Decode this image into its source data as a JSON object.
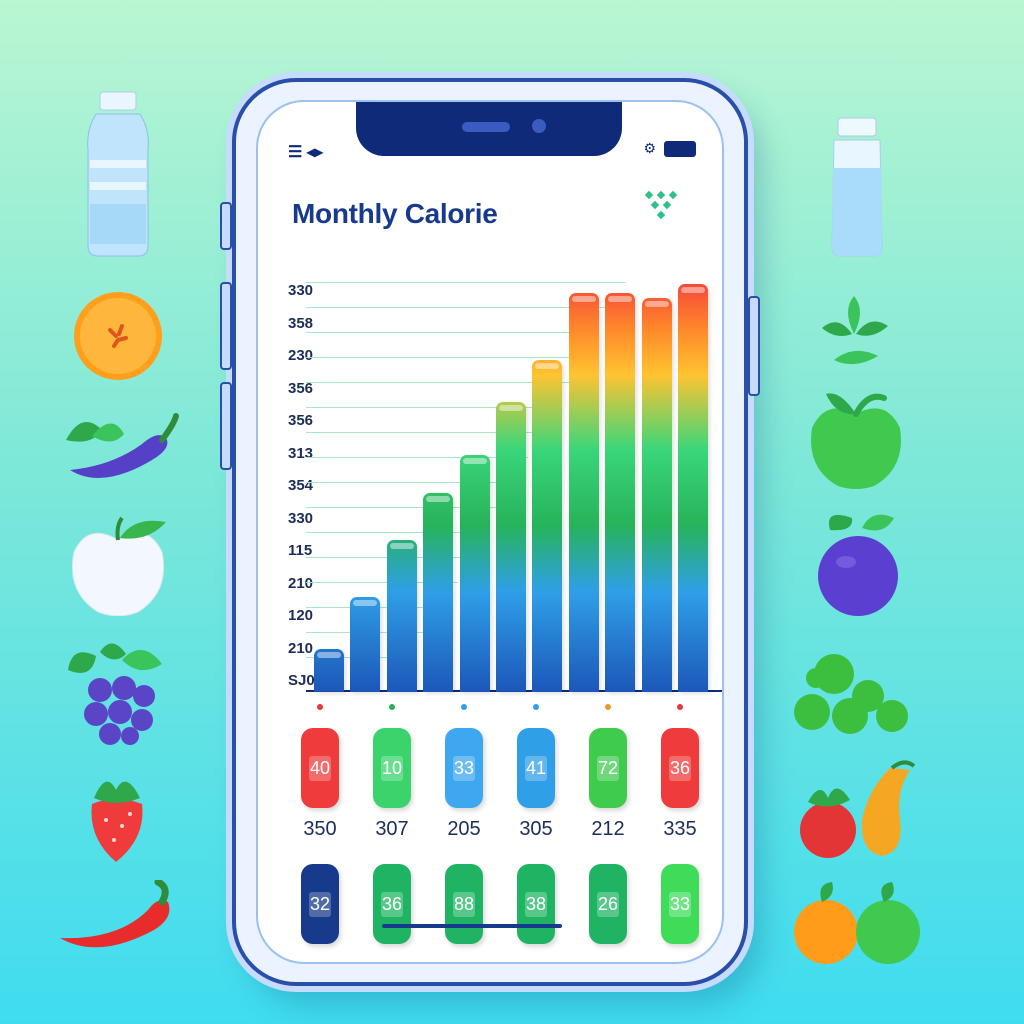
{
  "screen": {
    "title": "Monthly Calorie",
    "status_icons": {
      "left": "menu-icon",
      "right": "battery-icon"
    },
    "logo": "leaf-dots-logo"
  },
  "chart_data": {
    "type": "bar",
    "y_tick_labels": [
      "330",
      "358",
      "230",
      "356",
      "356",
      "313",
      "354",
      "330",
      "115",
      "210",
      "120",
      "210",
      "SJ0"
    ],
    "values": [
      45,
      100,
      160,
      210,
      250,
      305,
      350,
      420,
      420,
      415,
      430
    ],
    "ylim": [
      0,
      440
    ],
    "grid": true,
    "color_scheme": [
      "#f43b3b",
      "#ff8d2a",
      "#ffc331",
      "#3ad67a",
      "#27b35a",
      "#2f9fe8",
      "#1c57b8"
    ]
  },
  "summary": {
    "top_pills": [
      {
        "label": "40",
        "color": "#ef3b3b",
        "dot": "#e23a3a"
      },
      {
        "label": "10",
        "color": "#3bd36c",
        "dot": "#27b35a"
      },
      {
        "label": "33",
        "color": "#3da7f0",
        "dot": "#2f9fe8"
      },
      {
        "label": "41",
        "color": "#2f9fe8",
        "dot": "#2f9fe8"
      },
      {
        "label": "72",
        "color": "#3fcb4e",
        "dot": "#e69a2a"
      },
      {
        "label": "36",
        "color": "#ef3b3b",
        "dot": "#e23a3a"
      }
    ],
    "numbers": [
      "350",
      "307",
      "205",
      "305",
      "212",
      "335"
    ],
    "bottom_pills": [
      {
        "label": "32",
        "color": "#173a8c"
      },
      {
        "label": "36",
        "color": "#1fb463"
      },
      {
        "label": "88",
        "color": "#1fb463"
      },
      {
        "label": "38",
        "color": "#1fb463"
      },
      {
        "label": "26",
        "color": "#1fb463"
      },
      {
        "label": "33",
        "color": "#3fdc5a"
      }
    ]
  },
  "decorations": {
    "left": [
      "water-bottle-icon",
      "orange-icon",
      "eggplant-icon",
      "apple-icon",
      "blackberries-icon",
      "strawberry-icon",
      "chili-pepper-icon"
    ],
    "right": [
      "water-glass-icon",
      "leaves-icon",
      "green-apple-icon",
      "plum-icon",
      "grapes-icon",
      "fruit-pair-icon",
      "citrus-pair-icon"
    ]
  }
}
